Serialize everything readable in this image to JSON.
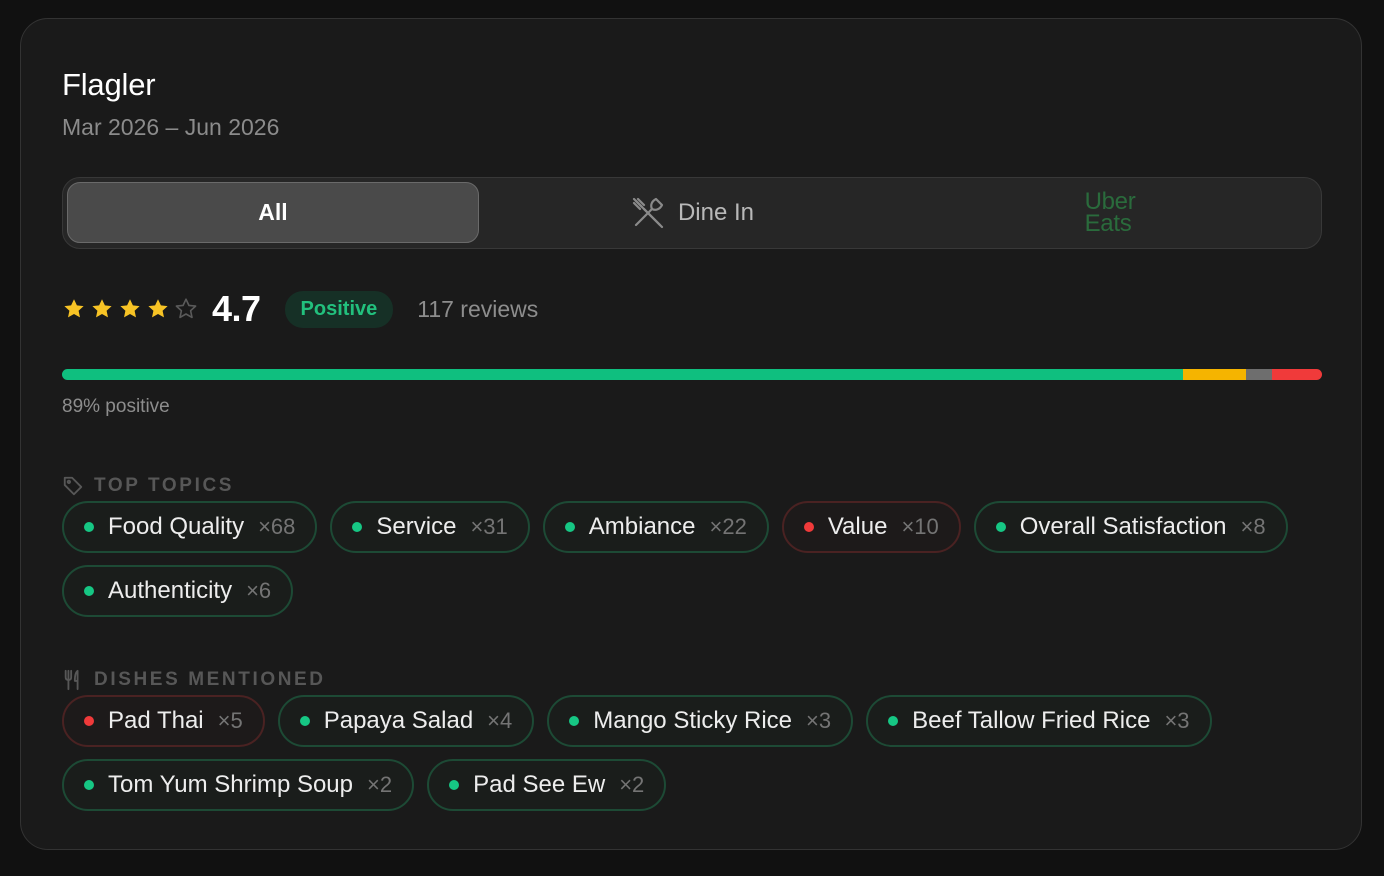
{
  "header": {
    "title": "Flagler",
    "date_range": "Mar 2026 – Jun 2026"
  },
  "tabs": [
    {
      "label": "All",
      "active": true
    },
    {
      "label": "Dine In",
      "icon": "fork-knife-crossed-icon",
      "active": false
    },
    {
      "label_line1": "Uber",
      "label_line2": "Eats",
      "icon": "uber-eats-logo",
      "active": false
    }
  ],
  "rating": {
    "stars_filled": 4,
    "stars_total": 5,
    "score": "4.7",
    "sentiment": "Positive",
    "reviews": "117 reviews"
  },
  "sentiment_bar": {
    "label": "89% positive",
    "segments": [
      {
        "name": "positive",
        "fraction": 0.89,
        "color": "#0fbf7f"
      },
      {
        "name": "mixed",
        "fraction": 0.05,
        "color": "#f5b400"
      },
      {
        "name": "neutral",
        "fraction": 0.02,
        "color": "#6e6e6e"
      },
      {
        "name": "negative",
        "fraction": 0.04,
        "color": "#f03a3a"
      }
    ]
  },
  "topics": {
    "heading": "TOP TOPICS",
    "icon": "tag-icon",
    "items": [
      {
        "name": "Food Quality",
        "count": "×68",
        "sentiment": "positive"
      },
      {
        "name": "Service",
        "count": "×31",
        "sentiment": "positive"
      },
      {
        "name": "Ambiance",
        "count": "×22",
        "sentiment": "positive"
      },
      {
        "name": "Value",
        "count": "×10",
        "sentiment": "negative"
      },
      {
        "name": "Overall Satisfaction",
        "count": "×8",
        "sentiment": "positive"
      },
      {
        "name": "Authenticity",
        "count": "×6",
        "sentiment": "positive"
      }
    ]
  },
  "dishes": {
    "heading": "DISHES MENTIONED",
    "icon": "utensils-icon",
    "items": [
      {
        "name": "Pad Thai",
        "count": "×5",
        "sentiment": "negative"
      },
      {
        "name": "Papaya Salad",
        "count": "×4",
        "sentiment": "positive"
      },
      {
        "name": "Mango Sticky Rice",
        "count": "×3",
        "sentiment": "positive"
      },
      {
        "name": "Beef Tallow Fried Rice",
        "count": "×3",
        "sentiment": "positive"
      },
      {
        "name": "Tom Yum Shrimp Soup",
        "count": "×2",
        "sentiment": "positive"
      },
      {
        "name": "Pad See Ew",
        "count": "×2",
        "sentiment": "positive"
      }
    ]
  },
  "colors": {
    "positive_dot": "#16c784",
    "negative_dot": "#f03a3a",
    "star_filled": "#f7c325",
    "star_empty": "#5a5a5a",
    "uber_green": "#2a6b3c"
  }
}
